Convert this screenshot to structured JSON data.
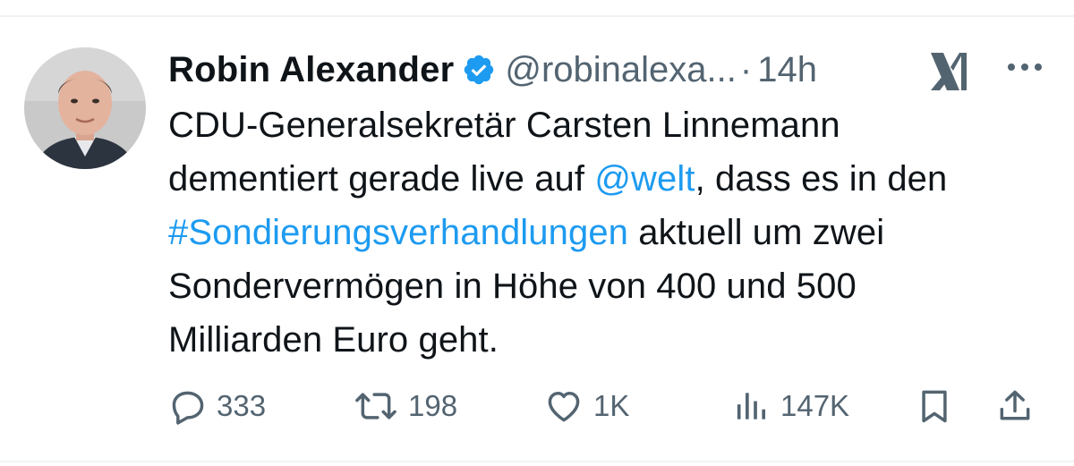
{
  "author": {
    "display_name": "Robin Alexander",
    "handle": "@robinalexa...",
    "separator": "·",
    "time": "14h",
    "verified_icon": "verified-badge-icon",
    "verified_color": "#1d9bf0"
  },
  "tweet": {
    "line1": "CDU-Generalsekretär Carsten Linnemann",
    "line2_pre": "dementiert gerade live auf ",
    "mention": "@welt",
    "line2_post": ", dass es in den",
    "hashtag": "#Sondierungsverhandlungen",
    "line3_post": " aktuell um zwei",
    "line4": "Sondervermögen in Höhe von 400 und 500",
    "line5": "Milliarden Euro geht."
  },
  "actions": {
    "replies": "333",
    "reposts": "198",
    "likes": "1K",
    "views": "147K"
  },
  "icons": {
    "grok": "grok-icon",
    "more": "more-icon",
    "reply": "reply-icon",
    "repost": "repost-icon",
    "like": "heart-icon",
    "views": "views-icon",
    "bookmark": "bookmark-icon",
    "share": "share-icon"
  },
  "colors": {
    "text": "#0f1419",
    "secondary": "#536471",
    "link": "#1d9bf0"
  }
}
